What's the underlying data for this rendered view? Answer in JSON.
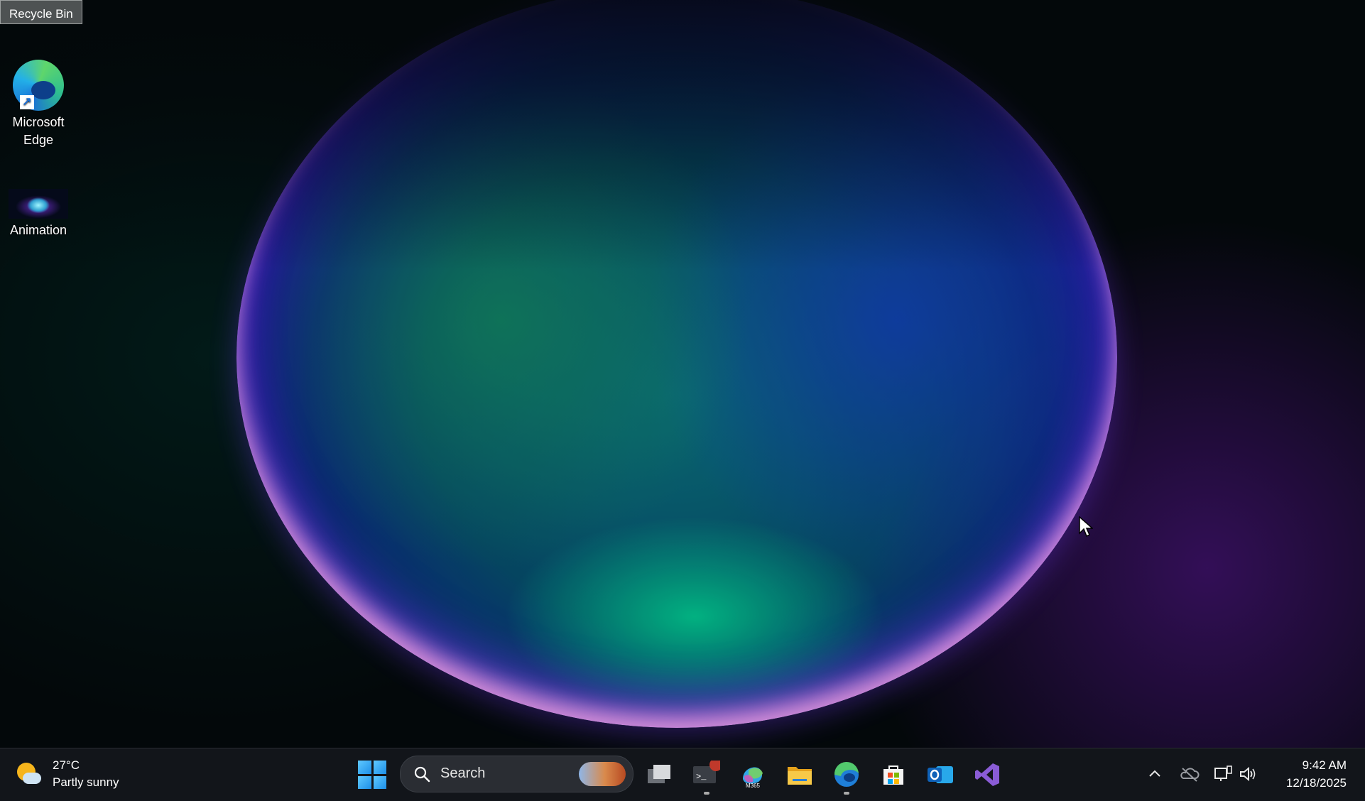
{
  "desktop": {
    "icons": [
      {
        "label": "Recycle Bin"
      },
      {
        "label": "Microsoft Edge"
      },
      {
        "label": "Animation"
      }
    ]
  },
  "taskbar": {
    "weather": {
      "temperature": "27°C",
      "condition": "Partly sunny",
      "icon": "partly-sunny-icon"
    },
    "search": {
      "placeholder": "Search"
    },
    "pinned": [
      {
        "name": "task-view-icon"
      },
      {
        "name": "terminal-icon",
        "running": true
      },
      {
        "name": "m365-copilot-icon",
        "badge": "M365"
      },
      {
        "name": "file-explorer-icon"
      },
      {
        "name": "edge-icon",
        "running": true
      },
      {
        "name": "store-icon"
      },
      {
        "name": "outlook-icon"
      },
      {
        "name": "visual-studio-icon"
      }
    ],
    "clock": {
      "time": "9:42 AM",
      "date": "12/18/2025"
    }
  },
  "colors": {
    "taskbar_bg": "#12151a",
    "accent": "#1d8fe8"
  }
}
